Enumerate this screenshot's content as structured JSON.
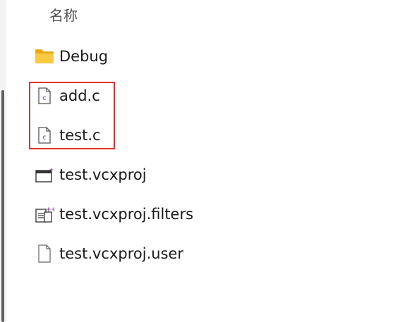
{
  "header": {
    "name_column": "名称"
  },
  "files": [
    {
      "name": "Debug",
      "icon": "folder-icon"
    },
    {
      "name": "add.c",
      "icon": "c-file-icon"
    },
    {
      "name": "test.c",
      "icon": "c-file-icon"
    },
    {
      "name": "test.vcxproj",
      "icon": "vcxproj-icon"
    },
    {
      "name": "test.vcxproj.filters",
      "icon": "filters-file-icon"
    },
    {
      "name": "test.vcxproj.user",
      "icon": "blank-file-icon"
    }
  ],
  "colors": {
    "highlight": "#e03131",
    "folder": "#f5c342",
    "c_badge": "#8e44ad"
  }
}
